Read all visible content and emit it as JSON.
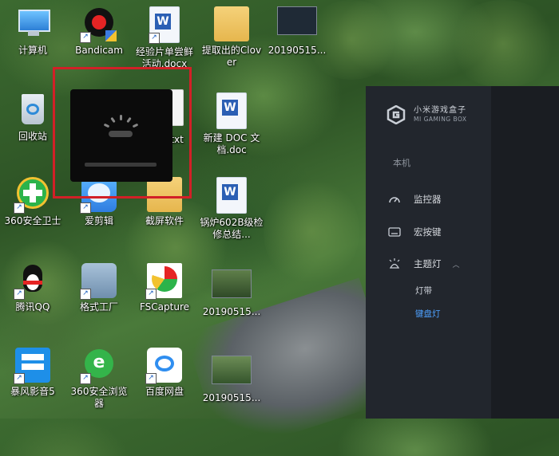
{
  "desktop": {
    "icons": [
      {
        "label": "计算机"
      },
      {
        "label": "Bandicam"
      },
      {
        "label": "经验片单尝鲜活动.docx"
      },
      {
        "label": "提取出的Clover"
      },
      {
        "label": "20190515..."
      },
      {
        "label": "回收站"
      },
      {
        "label": "...录.txt"
      },
      {
        "label": "新建 DOC 文档.doc"
      },
      {
        "label": "360安全卫士"
      },
      {
        "label": "爱剪辑"
      },
      {
        "label": "截屏软件"
      },
      {
        "label": "锅炉602B级检修总结..."
      },
      {
        "label": "腾讯QQ"
      },
      {
        "label": "格式工厂"
      },
      {
        "label": "FSCapture"
      },
      {
        "label": "20190515..."
      },
      {
        "label": "暴风影音5"
      },
      {
        "label": "360安全浏览器"
      },
      {
        "label": "百度网盘"
      },
      {
        "label": "20190515..."
      }
    ]
  },
  "gaming_box": {
    "brand_cn": "小米游戏盒子",
    "brand_en": "MI GAMING BOX",
    "section": "本机",
    "nav": [
      {
        "label": "监控器",
        "icon": "gauge-icon"
      },
      {
        "label": "宏按键",
        "icon": "keyboard-icon"
      },
      {
        "label": "主题灯",
        "icon": "light-icon",
        "expanded": true
      }
    ],
    "sub_items": [
      {
        "label": "灯带",
        "color": "#cfd3da"
      },
      {
        "label": "键盘灯",
        "color": "#4ea1ff"
      }
    ]
  }
}
